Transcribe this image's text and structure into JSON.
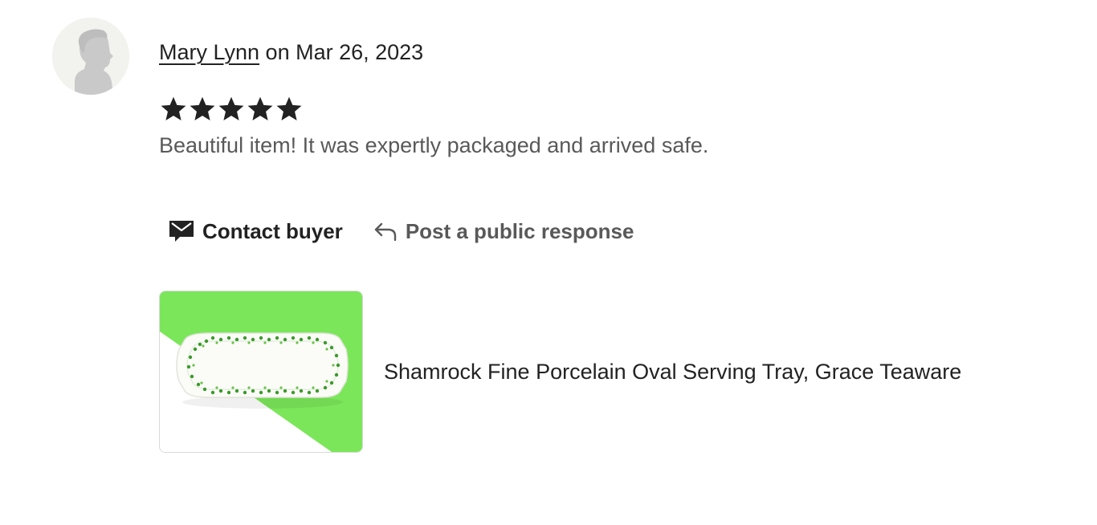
{
  "review": {
    "author": "Mary Lynn",
    "date_text": " on Mar 26, 2023",
    "rating": 5,
    "rating_max": 5,
    "text": "Beautiful item! It was expertly packaged and arrived safe."
  },
  "actions": {
    "contact_label": "Contact buyer",
    "contact_icon": "envelope-icon",
    "respond_label": "Post a public response",
    "respond_icon": "reply-arrow-icon"
  },
  "listing": {
    "title": "Shamrock Fine Porcelain Oval Serving Tray, Grace Teaware",
    "thumbnail_background": "#7be65a"
  },
  "colors": {
    "text_primary": "#222222",
    "text_secondary": "#595959",
    "avatar_bg": "#f2f2ee",
    "avatar_silhouette": "#c9c9c9",
    "star": "#222222",
    "shamrock_green": "#3a9a2a"
  }
}
